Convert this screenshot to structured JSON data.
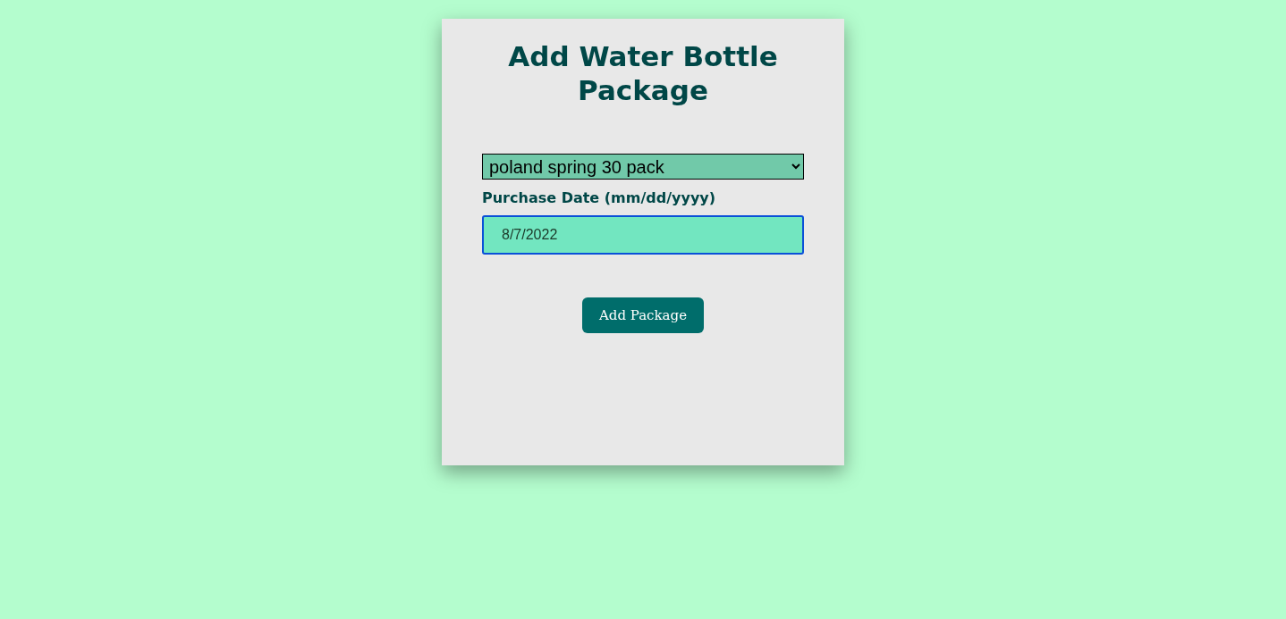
{
  "form": {
    "title": "Add Water Bottle Package",
    "package_select": {
      "value": "poland spring 30 pack"
    },
    "date_field": {
      "label": "Purchase Date (mm/dd/yyyy)",
      "value": "8/7/2022",
      "focused": true
    },
    "submit_button": {
      "label": "Add Package"
    }
  }
}
